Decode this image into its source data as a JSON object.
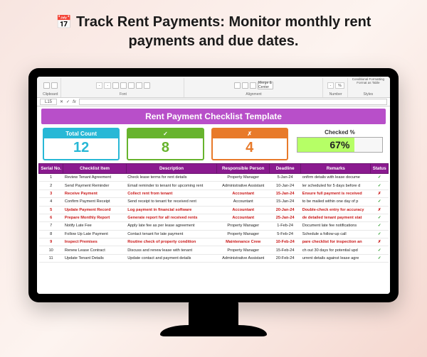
{
  "headline": {
    "icon": "📅",
    "text": "Track Rent Payments: Monitor monthly rent payments and due dates."
  },
  "ribbon": {
    "groups": [
      "Clipboard",
      "Font",
      "Alignment",
      "Number",
      "Styles"
    ],
    "merge_label": "Merge & Center",
    "dropdown1": "-",
    "dropdown2": "%",
    "cond_fmt": "Conditional Formatting",
    "fmt_table": "Format as Table",
    "font_name": "-",
    "font_size": "-"
  },
  "formula_bar": {
    "cell_ref": "L15",
    "fx_label": "fx"
  },
  "sheet": {
    "title": "Rent Payment Checklist Template",
    "cards": {
      "total": {
        "label": "Total Count",
        "value": "12"
      },
      "checked": {
        "label": "✓",
        "value": "8"
      },
      "unchecked": {
        "label": "✗",
        "value": "4"
      },
      "percent": {
        "label": "Checked %",
        "value": "67%",
        "fill_pct": 67
      }
    },
    "columns": [
      "Serial No.",
      "Checklist Item",
      "Description",
      "Responsible Person",
      "Deadline",
      "Remarks",
      "Status"
    ],
    "rows": [
      {
        "n": "1",
        "item": "Review Tenant Agreement",
        "desc": "Check lease terms for rent details",
        "resp": "Property Manager",
        "dl": "5-Jan-24",
        "rem": "onfirm details with lease docume",
        "st": "✓",
        "hl": false
      },
      {
        "n": "2",
        "item": "Send Payment Reminder",
        "desc": "Email reminder to tenant for upcoming rent",
        "resp": "Administrative Assistant",
        "dl": "10-Jan-24",
        "rem": "ler scheduled for 5 days before d",
        "st": "✓",
        "hl": false
      },
      {
        "n": "3",
        "item": "Receive Payment",
        "desc": "Collect rent from tenant",
        "resp": "Accountant",
        "dl": "15-Jan-24",
        "rem": "Ensure full payment is received",
        "st": "✗",
        "hl": true
      },
      {
        "n": "4",
        "item": "Confirm Payment Receipt",
        "desc": "Send receipt to tenant for received rent",
        "resp": "Accountant",
        "dl": "15-Jan-24",
        "rem": "to be mailed within one day of p",
        "st": "✓",
        "hl": false
      },
      {
        "n": "5",
        "item": "Update Payment Record",
        "desc": "Log payment in financial software",
        "resp": "Accountant",
        "dl": "20-Jan-24",
        "rem": "Double-check entry for accuracy",
        "st": "✗",
        "hl": true
      },
      {
        "n": "6",
        "item": "Prepare Monthly Report",
        "desc": "Generate report for all received rents",
        "resp": "Accountant",
        "dl": "25-Jan-24",
        "rem": "de detailed tenant payment stat",
        "st": "✓",
        "hl": true
      },
      {
        "n": "7",
        "item": "Notify Late Fee",
        "desc": "Apply late fee as per lease agreement",
        "resp": "Property Manager",
        "dl": "1-Feb-24",
        "rem": "Document late fee notifications",
        "st": "✓",
        "hl": false
      },
      {
        "n": "8",
        "item": "Follow Up Late Payment",
        "desc": "Contact tenant for late payment",
        "resp": "Property Manager",
        "dl": "5-Feb-24",
        "rem": "Schedule a follow-up call",
        "st": "✓",
        "hl": false
      },
      {
        "n": "9",
        "item": "Inspect Premises",
        "desc": "Routine check of property condition",
        "resp": "Maintenance Crew",
        "dl": "10-Feb-24",
        "rem": "pare checklist for inspection an",
        "st": "✗",
        "hl": true
      },
      {
        "n": "10",
        "item": "Renew Lease Contract",
        "desc": "Discuss and renew lease with tenant",
        "resp": "Property Manager",
        "dl": "15-Feb-24",
        "rem": "ch out 30 days for potential upd",
        "st": "✓",
        "hl": false
      },
      {
        "n": "11",
        "item": "Update Tenant Details",
        "desc": "Update contact and payment details",
        "resp": "Administrative Assistant",
        "dl": "20-Feb-24",
        "rem": "urrent details against lease agre",
        "st": "✓",
        "hl": false
      }
    ]
  }
}
